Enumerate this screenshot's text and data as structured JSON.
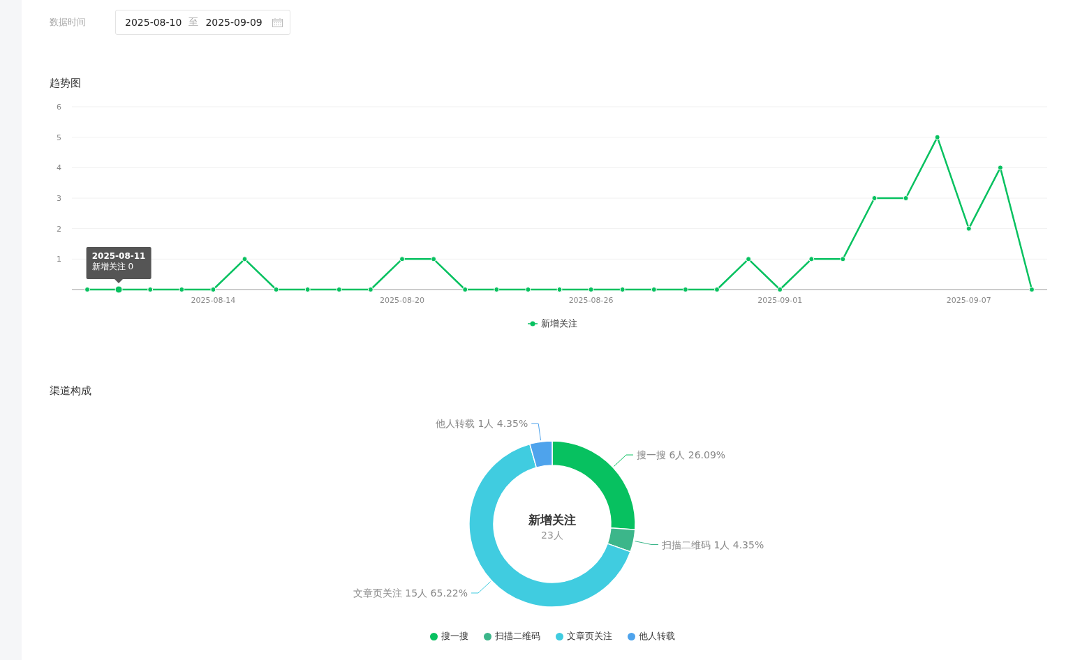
{
  "filter": {
    "label": "数据时间",
    "start": "2025-08-10",
    "separator": "至",
    "end": "2025-09-09"
  },
  "trend": {
    "title": "趋势图",
    "tooltip": {
      "title": "2025-08-11",
      "text": "新增关注 0"
    },
    "chart_data": {
      "type": "line",
      "grid": true,
      "categories": [
        null,
        null,
        null,
        null,
        "2025-08-14",
        null,
        null,
        null,
        null,
        null,
        "2025-08-20",
        null,
        null,
        null,
        null,
        null,
        "2025-08-26",
        null,
        null,
        null,
        null,
        null,
        "2025-09-01",
        null,
        null,
        null,
        null,
        null,
        "2025-09-07",
        null,
        null
      ],
      "series": [
        {
          "name": "新增关注",
          "color": "#07c160",
          "marker": "circle",
          "values": [
            0,
            0,
            0,
            0,
            0,
            1,
            0,
            0,
            0,
            0,
            1,
            1,
            0,
            0,
            0,
            0,
            0,
            0,
            0,
            0,
            0,
            1,
            0,
            1,
            1,
            3,
            3,
            5,
            2,
            4,
            0
          ]
        }
      ],
      "ylim": [
        0,
        6
      ],
      "yticks": [
        1,
        2,
        3,
        4,
        5,
        6
      ]
    }
  },
  "channels": {
    "title": "渠道构成",
    "total": "23人",
    "chart_data": {
      "type": "donut",
      "title": "新增关注",
      "categories": [
        "搜一搜",
        "扫描二维码",
        "文章页关注",
        "他人转载"
      ],
      "series": [
        {
          "values": [
            26.09,
            4.35,
            65.22,
            4.35
          ]
        }
      ],
      "colors": [
        "#07c160",
        "#3cb68a",
        "#40cce0",
        "#4ea3ec"
      ],
      "value_labels": [
        "搜一搜 6人 26.09%",
        "扫描二维码 1人 4.35%",
        "文章页关注 15人 65.22%",
        "他人转载 1人 4.35%"
      ]
    }
  }
}
